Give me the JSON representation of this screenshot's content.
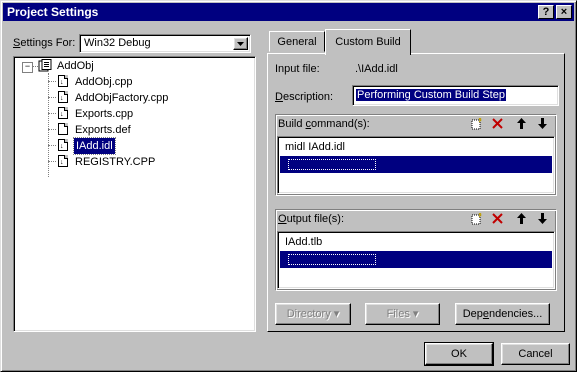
{
  "window": {
    "title": "Project Settings",
    "help_btn": "?",
    "close_btn": "×"
  },
  "settings_for": {
    "label_u": "S",
    "label_rest": "ettings For:",
    "value": "Win32 Debug"
  },
  "tree": {
    "root": "AddObj",
    "items": [
      "AddObj.cpp",
      "AddObjFactory.cpp",
      "Exports.cpp",
      "Exports.def",
      "IAdd.idl",
      "REGISTRY.CPP"
    ],
    "selected": "IAdd.idl"
  },
  "tabs": [
    "General",
    "Custom Build"
  ],
  "active_tab": "Custom Build",
  "input_file": {
    "label": "Input file:",
    "value": ".\\IAdd.idl"
  },
  "description": {
    "label_u": "D",
    "label_rest": "escription:",
    "value": "Performing Custom Build Step"
  },
  "build_commands": {
    "label_pre": "Build ",
    "label_u": "c",
    "label_post": "ommand(s):",
    "rows": [
      "midl IAdd.idl"
    ]
  },
  "output_files": {
    "label_u": "O",
    "label_rest": "utput file(s):",
    "rows": [
      "IAdd.tlb"
    ]
  },
  "buttons": {
    "directory": "Directory",
    "files": "Files",
    "dependencies_pre": "Dep",
    "dependencies_u": "e",
    "dependencies_post": "ndencies...",
    "ok": "OK",
    "cancel": "Cancel"
  },
  "icons": [
    "new-item-icon",
    "delete-icon",
    "move-up-icon",
    "move-down-icon",
    "file-icon",
    "project-icon",
    "dropdown-arrow-icon"
  ]
}
